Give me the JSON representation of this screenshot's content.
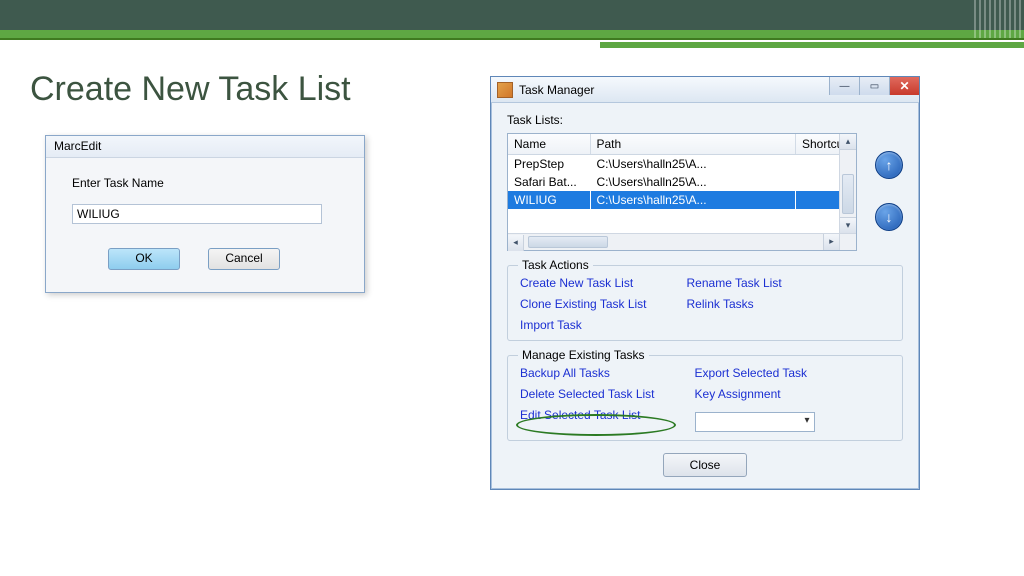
{
  "slide": {
    "title": "Create New Task List"
  },
  "marcedit": {
    "title": "MarcEdit",
    "label": "Enter Task Name",
    "value": "WILIUG",
    "ok": "OK",
    "cancel": "Cancel"
  },
  "tm": {
    "title": "Task Manager",
    "lists_label": "Task Lists:",
    "columns": {
      "name": "Name",
      "path": "Path",
      "shortcut": "Shortcut"
    },
    "rows": [
      {
        "name": "PrepStep",
        "path": "C:\\Users\\halln25\\A...",
        "shortcut": ""
      },
      {
        "name": "Safari Bat...",
        "path": "C:\\Users\\halln25\\A...",
        "shortcut": ""
      },
      {
        "name": "WILIUG",
        "path": "C:\\Users\\halln25\\A...",
        "shortcut": "",
        "selected": true
      }
    ],
    "actions": {
      "legend": "Task Actions",
      "left": [
        "Create New Task List",
        "Clone Existing Task List",
        "Import Task"
      ],
      "right": [
        "Rename Task List",
        "Relink Tasks"
      ]
    },
    "manage": {
      "legend": "Manage Existing Tasks",
      "left": [
        "Backup All Tasks",
        "Delete Selected Task List",
        "Edit Selected Task List"
      ],
      "right": [
        "Export Selected Task",
        "Key Assignment"
      ]
    },
    "close": "Close"
  }
}
